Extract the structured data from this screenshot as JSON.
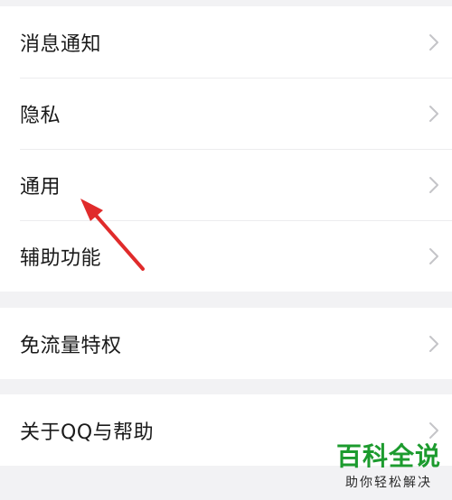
{
  "settings": {
    "group1": [
      {
        "label": "消息通知",
        "icon": "chevron-right-icon"
      },
      {
        "label": "隐私",
        "icon": "chevron-right-icon"
      },
      {
        "label": "通用",
        "icon": "chevron-right-icon"
      },
      {
        "label": "辅助功能",
        "icon": "chevron-right-icon"
      }
    ],
    "group2": [
      {
        "label": "免流量特权",
        "icon": "chevron-right-icon"
      }
    ],
    "group3": [
      {
        "label": "关于QQ与帮助",
        "icon": "chevron-right-icon"
      }
    ]
  },
  "annotation": {
    "arrow_color": "#e02b2b",
    "points_to": "通用"
  },
  "watermark": {
    "title": "百科全说",
    "subtitle": "助你轻松解决",
    "color": "#1c9b2e"
  },
  "colors": {
    "background": "#f2f2f4",
    "row_background": "#ffffff",
    "text": "#1a1a1a",
    "chevron": "#c4c4c8"
  }
}
